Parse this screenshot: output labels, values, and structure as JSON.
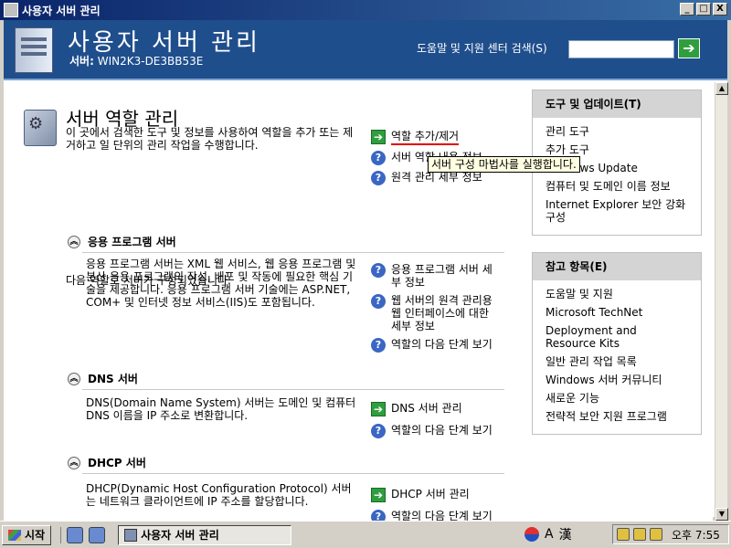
{
  "window": {
    "title": "사용자 서버 관리",
    "minimize": "_",
    "maximize": "□",
    "close": "X"
  },
  "header": {
    "title": "사용자 서버 관리",
    "server_label": "서버:",
    "server_name": "WIN2K3-DE3BB53E",
    "help_text": "도움말 및 지원 센터 검색(S)",
    "search_value": "",
    "go_label": "➔"
  },
  "main": {
    "section_title": "서버 역할 관리",
    "section_desc": "이 곳에서 검색한 도구 및 정보를 사용하여 역할을 추가 또는 제거하고 일 단위의 관리 작업을 수행합니다.",
    "links": [
      {
        "label": "역할 추가/제거",
        "icon": "arrow-go-icon"
      },
      {
        "label": "서버 역할 내용 정보",
        "icon": "help-icon"
      },
      {
        "label": "원격 관리 세부 정보",
        "icon": "help-icon"
      }
    ],
    "tooltip": "서버 구성 마법사를 실행합니다.",
    "configured_text": "다음 역할로 서버가 구성되었습니다.",
    "roles": [
      {
        "title": "응용 프로그램 서버",
        "desc": "응용 프로그램 서버는 XML 웹 서비스, 웹 응용 프로그램 및 분산 응용 프로그램의 작성, 배포 및 작동에 필요한 핵심 기술을 제공합니다. 응용 프로그램 서버 기술에는 ASP.NET, COM+ 및 인터넷 정보 서비스(IIS)도 포함됩니다.",
        "links": [
          {
            "label": "응용 프로그램 서버 세부 정보",
            "icon": "help-icon"
          },
          {
            "label": "웹 서버의 원격 관리용 웹 인터페이스에 대한 세부 정보",
            "icon": "help-icon"
          },
          {
            "label": "역할의 다음 단계 보기",
            "icon": "help-icon"
          }
        ]
      },
      {
        "title": "DNS 서버",
        "desc": "DNS(Domain Name System) 서버는 도메인 및 컴퓨터 DNS 이름을 IP 주소로 변환합니다.",
        "links": [
          {
            "label": "DNS 서버 관리",
            "icon": "arrow-go-icon"
          },
          {
            "label": "역할의 다음 단계 보기",
            "icon": "help-icon"
          }
        ]
      },
      {
        "title": "DHCP 서버",
        "desc": "DHCP(Dynamic Host Configuration Protocol) 서버는 네트워크 클라이언트에 IP 주소를 할당합니다.",
        "links": [
          {
            "label": "DHCP 서버 관리",
            "icon": "arrow-go-icon"
          },
          {
            "label": "역할의 다음 단계 보기",
            "icon": "help-icon"
          }
        ]
      }
    ]
  },
  "sidebar": {
    "tools": {
      "title": "도구 및 업데이트(T)",
      "items": [
        "관리 도구",
        "추가 도구",
        "Windows Update",
        "컴퓨터 및 도메인 이름 정보",
        "Internet Explorer 보안 강화 구성"
      ]
    },
    "refs": {
      "title": "참고 항목(E)",
      "items": [
        "도움말 및 지원",
        "Microsoft TechNet",
        "Deployment and Resource Kits",
        "일반 관리 작업 목록",
        "Windows 서버 커뮤니티",
        "새로운 기능",
        "전략적 보안 지원 프로그램"
      ]
    }
  },
  "taskbar": {
    "start_label": "시작",
    "task_label": "사용자 서버 관리",
    "ime_a": "A",
    "ime_han": "漢",
    "clock": "오후 7:55"
  },
  "colors": {
    "header_bg": "#1f4e8c",
    "title_gradient_start": "#0a246a",
    "link_underline": "#e00000",
    "tooltip_bg": "#ffffe1"
  }
}
